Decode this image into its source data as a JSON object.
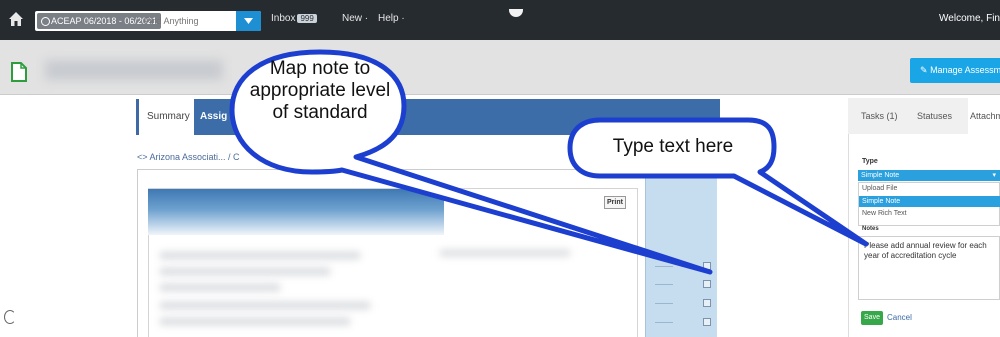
{
  "topnav": {
    "scope_chip": "ACEAP 06/2018 - 06/2021",
    "search_placeholder": "Find Anything",
    "inbox_label": "Inbox",
    "inbox_count": "999",
    "new_label": "New ·",
    "help_label": "Help ·",
    "welcome_text": "Welcome, Fin"
  },
  "header": {
    "manage_button": "Manage Assessment"
  },
  "main": {
    "tab_summary": "Summary",
    "tab_assign": "Assig",
    "breadcrumb": "<> Arizona Associati... / C",
    "print_button": "Print"
  },
  "right_panel": {
    "tabs": {
      "tasks": "Tasks (1)",
      "statuses": "Statuses",
      "attach": "Attachm"
    },
    "type_label": "Type",
    "type_selected": "Simple Note",
    "type_options": [
      "Upload File",
      "Simple Note",
      "New Rich Text"
    ],
    "notes_label": "Notes",
    "notes_text": "Please add annual review for each year of accreditation cycle",
    "save_button": "Save",
    "cancel_link": "Cancel"
  },
  "callouts": {
    "map_note": "Map note to appropriate level of standard",
    "type_text": "Type text here"
  },
  "colors": {
    "nav_bg": "#262b30",
    "accent_blue": "#1aa5e6",
    "tab_blue": "#3d6da8",
    "callout_stroke": "#1c3fd0",
    "save_green": "#36a84a"
  }
}
